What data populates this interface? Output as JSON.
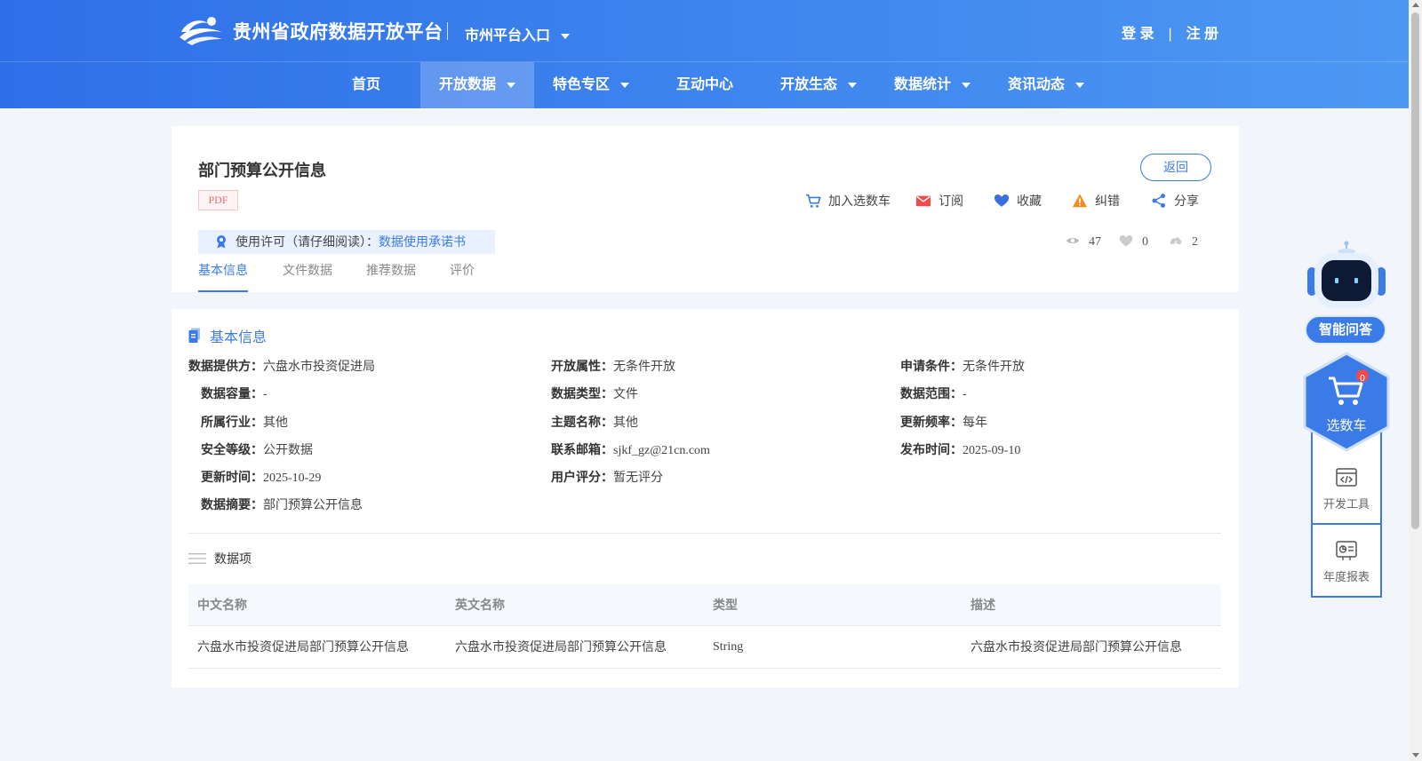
{
  "header": {
    "site_title": "贵州省政府数据开放平台",
    "city_entry": "市州平台入口",
    "login": "登 录",
    "auth_sep": "|",
    "register": "注 册"
  },
  "nav": {
    "items": [
      {
        "label": "首页",
        "dropdown": false,
        "active": false
      },
      {
        "label": "开放数据",
        "dropdown": true,
        "active": true
      },
      {
        "label": "特色专区",
        "dropdown": true,
        "active": false
      },
      {
        "label": "互动中心",
        "dropdown": false,
        "active": false
      },
      {
        "label": "开放生态",
        "dropdown": true,
        "active": false
      },
      {
        "label": "数据统计",
        "dropdown": true,
        "active": false
      },
      {
        "label": "资讯动态",
        "dropdown": true,
        "active": false
      }
    ]
  },
  "detail": {
    "title": "部门预算公开信息",
    "format_tag": "PDF",
    "back_label": "返回",
    "actions": {
      "cart": "加入选数车",
      "subscribe": "订阅",
      "favorite": "收藏",
      "report": "纠错",
      "share": "分享"
    },
    "license": {
      "label": "使用许可（请仔细阅读）：",
      "link": "数据使用承诺书"
    },
    "stats": {
      "views": "47",
      "likes": "0",
      "downloads": "2"
    },
    "tabs": [
      "基本信息",
      "文件数据",
      "推荐数据",
      "评价"
    ]
  },
  "basic_info": {
    "section_title": "基本信息",
    "col1": [
      {
        "label": "数据提供方：",
        "value": "六盘水市投资促进局"
      },
      {
        "label": "数据容量：",
        "value": "-"
      },
      {
        "label": "所属行业：",
        "value": "其他"
      },
      {
        "label": "安全等级：",
        "value": "公开数据"
      },
      {
        "label": "更新时间：",
        "value": "2025-10-29"
      },
      {
        "label": "数据摘要：",
        "value": "部门预算公开信息"
      }
    ],
    "col2": [
      {
        "label": "开放属性：",
        "value": "无条件开放"
      },
      {
        "label": "数据类型：",
        "value": "文件"
      },
      {
        "label": "主题名称：",
        "value": "其他"
      },
      {
        "label": "联系邮箱：",
        "value": "sjkf_gz@21cn.com"
      },
      {
        "label": "用户评分：",
        "value": "暂无评分"
      }
    ],
    "col3": [
      {
        "label": "申请条件：",
        "value": "无条件开放"
      },
      {
        "label": "数据范围：",
        "value": "-"
      },
      {
        "label": "更新频率：",
        "value": "每年"
      },
      {
        "label": "发布时间：",
        "value": "2025-09-10"
      }
    ]
  },
  "data_items": {
    "title": "数据项",
    "headers": [
      "中文名称",
      "英文名称",
      "类型",
      "描述"
    ],
    "rows": [
      [
        "六盘水市投资促进局部门预算公开信息",
        "六盘水市投资促进局部门预算公开信息",
        "String",
        "六盘水市投资促进局部门预算公开信息"
      ]
    ]
  },
  "widgets": {
    "qa": "智能问答",
    "cart": "选数车",
    "cart_count": "0",
    "dev_tools": "开发工具",
    "annual_report": "年度报表"
  },
  "colors": {
    "primary": "#3a7be8",
    "header_start": "#2f6fe8",
    "header_end": "#4d98f3",
    "page_bg": "#f2f5f9"
  }
}
